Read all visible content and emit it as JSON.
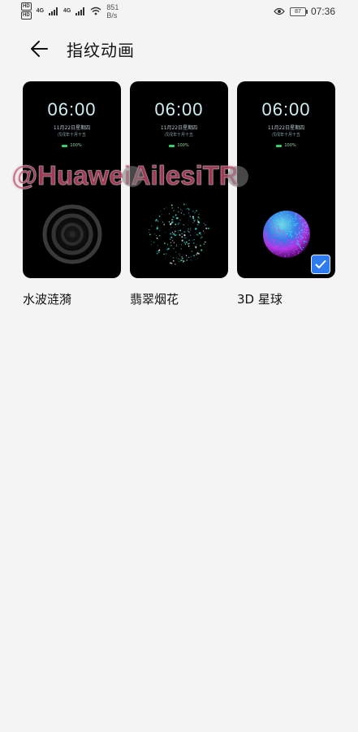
{
  "status_bar": {
    "hd1": "HD",
    "hd2": "HD",
    "net1": "4G",
    "net2": "4G",
    "speed_value": "851",
    "speed_unit": "B/s",
    "battery": "87",
    "time": "07:36",
    "icons": [
      "signal-icon",
      "wifi-icon",
      "eye-icon",
      "battery-icon"
    ]
  },
  "header": {
    "title": "指纹动画"
  },
  "preview": {
    "time": "06:00",
    "date": "11月22日星期四",
    "lunar": "戊戌年十月十五",
    "charge": "100%"
  },
  "options": [
    {
      "label": "水波涟漪",
      "selected": false
    },
    {
      "label": "翡翠烟花",
      "selected": false
    },
    {
      "label": "3D 星球",
      "selected": true
    }
  ],
  "watermark": "@HuaweiAilesiTR",
  "colors": {
    "accent": "#2f7bf0",
    "card_bg": "#000000",
    "page_bg": "#f4f4f4",
    "firework": "#35d0c0",
    "planet_cyan": "#38e0ff",
    "planet_magenta": "#d63cff"
  }
}
